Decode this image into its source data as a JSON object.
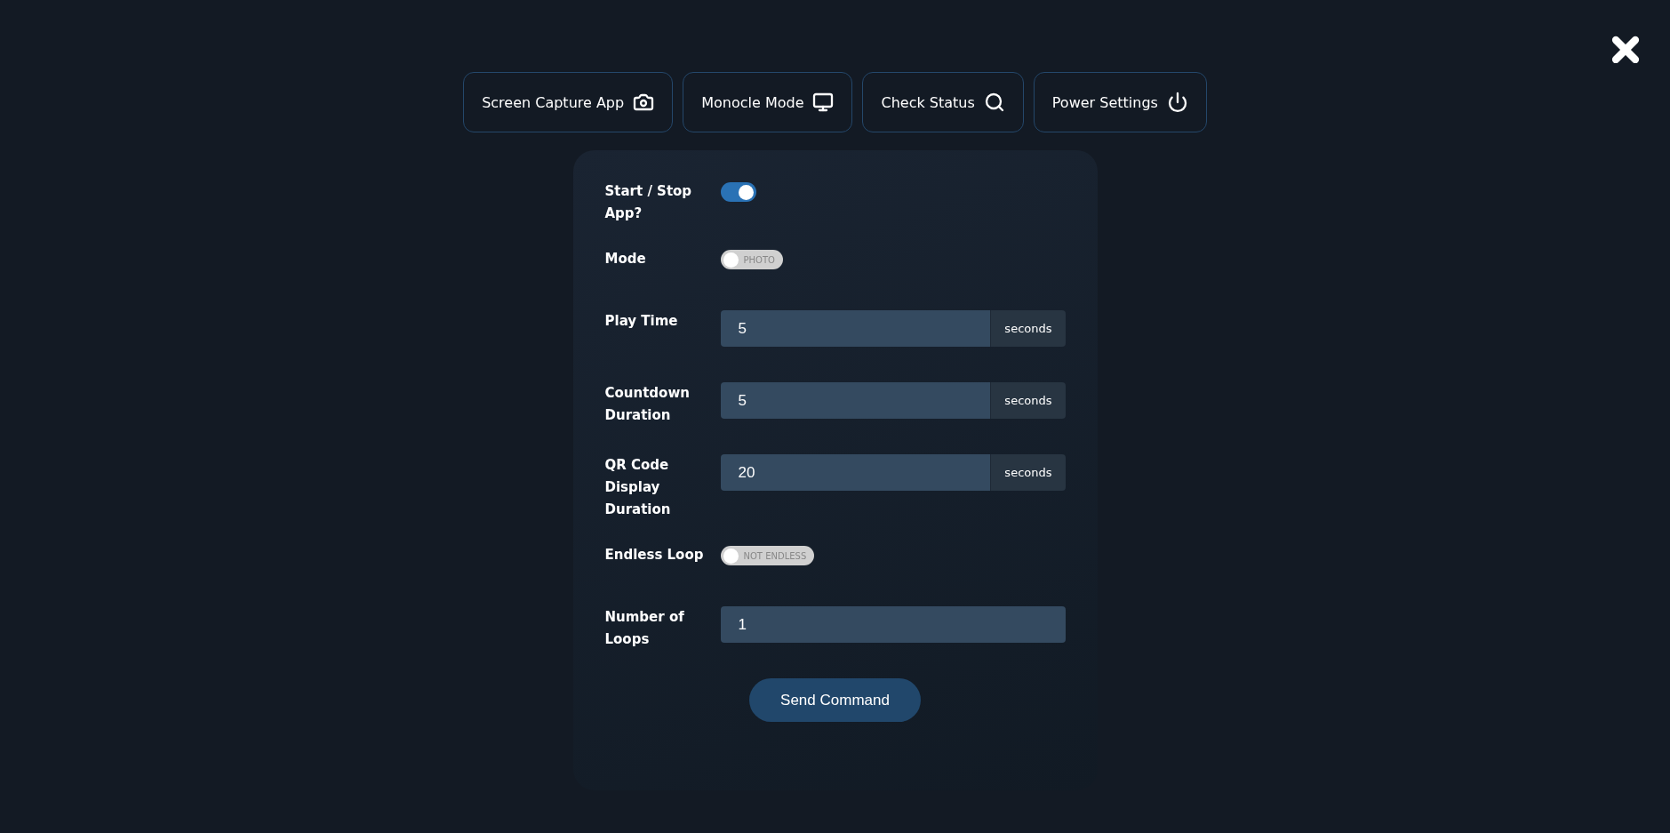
{
  "nav": [
    {
      "label": "Screen Capture App"
    },
    {
      "label": "Monocle Mode"
    },
    {
      "label": "Check Status"
    },
    {
      "label": "Power Settings"
    }
  ],
  "form": {
    "fields": [
      {
        "kind": "switch",
        "label": "Start / Stop App?",
        "on": true
      },
      {
        "kind": "switch",
        "label": "Mode",
        "on": false,
        "text": "PHOTO"
      },
      {
        "kind": "number",
        "label": "Play Time",
        "value": "5",
        "suffix": "seconds"
      },
      {
        "kind": "number",
        "label": "Countdown Duration",
        "value": "5",
        "suffix": "seconds"
      },
      {
        "kind": "number",
        "label": "QR Code Display Duration",
        "value": "20",
        "suffix": "seconds"
      },
      {
        "kind": "switch",
        "label": "Endless Loop",
        "on": false,
        "text": "NOT ENDLESS"
      },
      {
        "kind": "number",
        "label": "Number of Loops",
        "value": "1"
      }
    ],
    "submit": "Send Command"
  }
}
